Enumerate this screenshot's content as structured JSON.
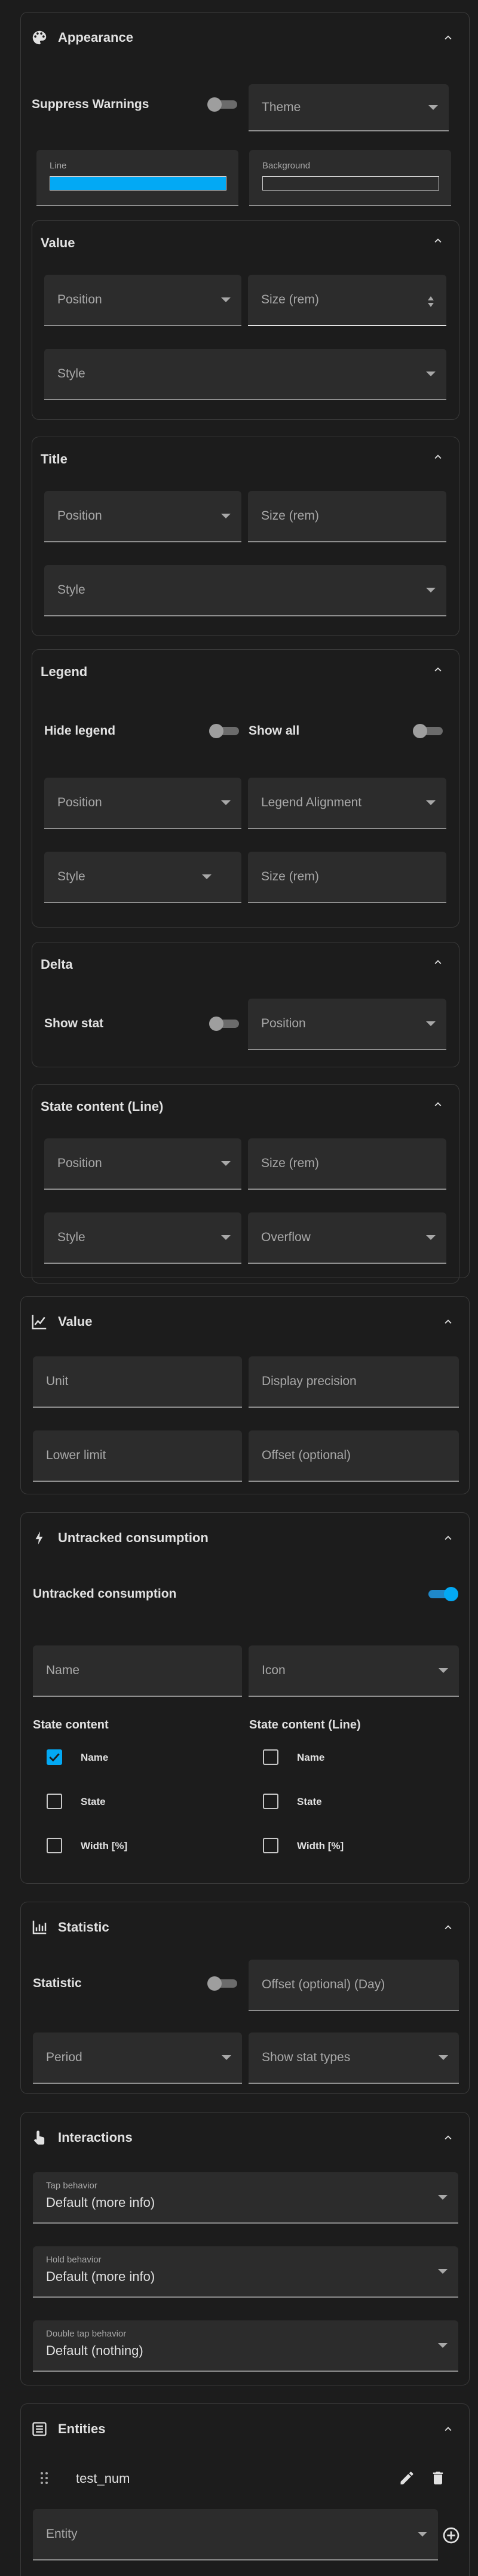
{
  "appearance": {
    "title": "Appearance",
    "suppress_warnings_label": "Suppress Warnings",
    "theme_label": "Theme",
    "line_label": "Line",
    "line_color": "#03a9f4",
    "background_label": "Background",
    "value_section": {
      "title": "Value",
      "position": "Position",
      "size": "Size (rem)",
      "style": "Style"
    },
    "title_section": {
      "title": "Title",
      "position": "Position",
      "size": "Size (rem)",
      "style": "Style"
    },
    "legend_section": {
      "title": "Legend",
      "hide_legend": "Hide legend",
      "show_all": "Show all",
      "position": "Position",
      "alignment": "Legend Alignment",
      "style": "Style",
      "size": "Size (rem)"
    },
    "delta_section": {
      "title": "Delta",
      "show_stat": "Show stat",
      "position": "Position"
    },
    "state_content_section": {
      "title": "State content (Line)",
      "position": "Position",
      "size": "Size (rem)",
      "style": "Style",
      "overflow": "Overflow"
    }
  },
  "value": {
    "title": "Value",
    "unit": "Unit",
    "display_precision": "Display precision",
    "lower_limit": "Lower limit",
    "offset": "Offset (optional)"
  },
  "untracked": {
    "title": "Untracked consumption",
    "toggle_label": "Untracked consumption",
    "name": "Name",
    "icon": "Icon",
    "state_content_header": "State content",
    "state_content_line_header": "State content (Line)",
    "left_items": [
      "Name",
      "State",
      "Width [%]"
    ],
    "right_items": [
      "Name",
      "State",
      "Width [%]"
    ]
  },
  "statistic": {
    "title": "Statistic",
    "statistic_label": "Statistic",
    "offset_day": "Offset (optional) (Day)",
    "period": "Period",
    "show_stat_types": "Show stat types"
  },
  "interactions": {
    "title": "Interactions",
    "tap_label": "Tap behavior",
    "tap_value": "Default (more info)",
    "hold_label": "Hold behavior",
    "hold_value": "Default (more info)",
    "double_tap_label": "Double tap behavior",
    "double_tap_value": "Default (nothing)"
  },
  "entities": {
    "title": "Entities",
    "entity_name": "test_num",
    "entity_placeholder": "Entity"
  }
}
